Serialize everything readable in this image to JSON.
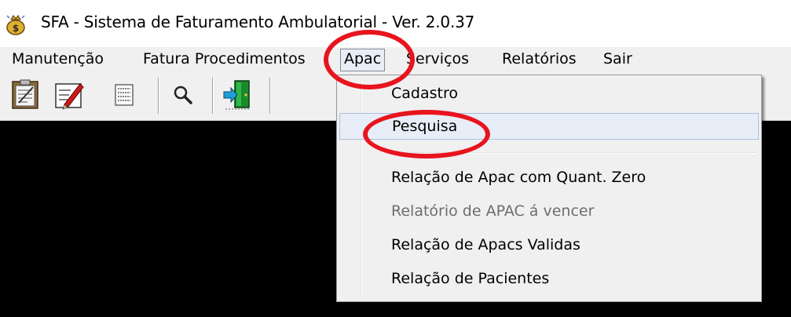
{
  "window": {
    "title": "SFA - Sistema de Faturamento Ambulatorial - Ver. 2.0.37",
    "icon": "money-bag-icon"
  },
  "menubar": {
    "items": [
      {
        "label": "Manutenção"
      },
      {
        "label": "Fatura Procedimentos"
      },
      {
        "label": "Apac",
        "active": true
      },
      {
        "label": "Serviços"
      },
      {
        "label": "Relatórios"
      },
      {
        "label": "Sair"
      }
    ]
  },
  "toolbar": {
    "buttons": [
      {
        "icon": "clipboard-icon"
      },
      {
        "icon": "document-edit-icon"
      },
      {
        "icon": "list-document-icon"
      },
      {
        "icon": "magnifier-icon"
      },
      {
        "icon": "exit-door-icon"
      }
    ]
  },
  "dropdown": {
    "items": [
      {
        "label": "Cadastro",
        "enabled": true
      },
      {
        "label": "Pesquisa",
        "enabled": true,
        "highlighted": true
      },
      {
        "label": "Relação de Apac com Quant. Zero",
        "enabled": true
      },
      {
        "label": "Relatório de APAC á vencer",
        "enabled": false
      },
      {
        "label": "Relação de Apacs Validas",
        "enabled": true
      },
      {
        "label": "Relação de Pacientes",
        "enabled": true
      }
    ]
  },
  "colors": {
    "annotation": "#e8141e",
    "client_background": "#000000",
    "menu_background": "#f0f0f0",
    "hover_highlight": "#e8eef7"
  }
}
